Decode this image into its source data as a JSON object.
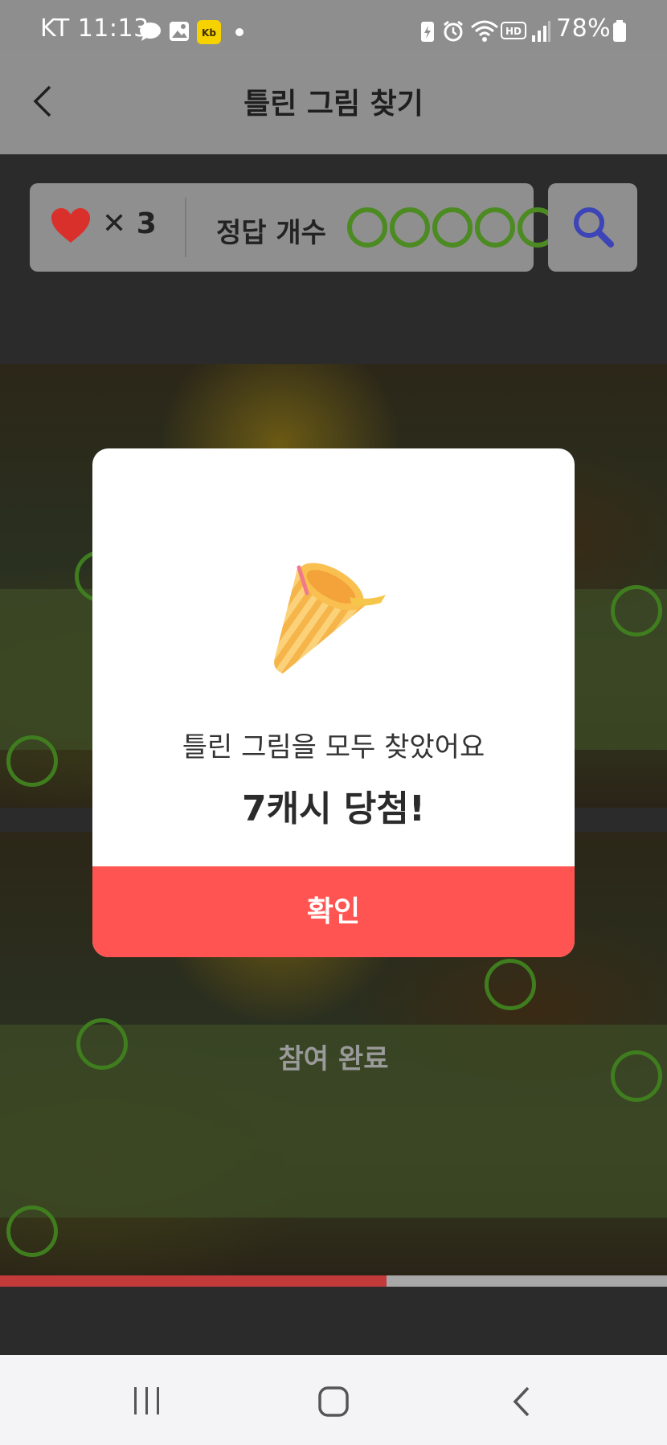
{
  "status_bar": {
    "carrier_time": "KT 11:13",
    "battery": "78%",
    "icons": [
      "talk-icon",
      "gallery-icon",
      "app-badge-icon",
      "dot-icon",
      "battery-saver-icon",
      "alarm-icon",
      "wifi-icon",
      "hd-icon",
      "signal-icon",
      "battery-icon"
    ]
  },
  "header": {
    "title": "틀린 그림 찾기",
    "back_icon": "chevron-left-icon"
  },
  "info": {
    "lives": "✕ 3",
    "answer_label": "정답 개수",
    "answers_found": 5,
    "heart_color": "#d9302c",
    "circle_color": "#4c8a22"
  },
  "search_icon": "magnifier-icon",
  "photo": {
    "done_label": "참여 완료"
  },
  "progress": {
    "fraction": 0.58,
    "fill_color": "#c23a3a"
  },
  "modal": {
    "message": "틀린 그림을 모두 찾았어요",
    "prize": "7캐시 당첨!",
    "confirm": "확인",
    "icon": "party-popper-icon",
    "button_color": "#ff5451"
  },
  "navbar": {
    "recent_icon": "recent-apps-icon",
    "home_icon": "home-icon",
    "back_icon": "back-icon"
  }
}
